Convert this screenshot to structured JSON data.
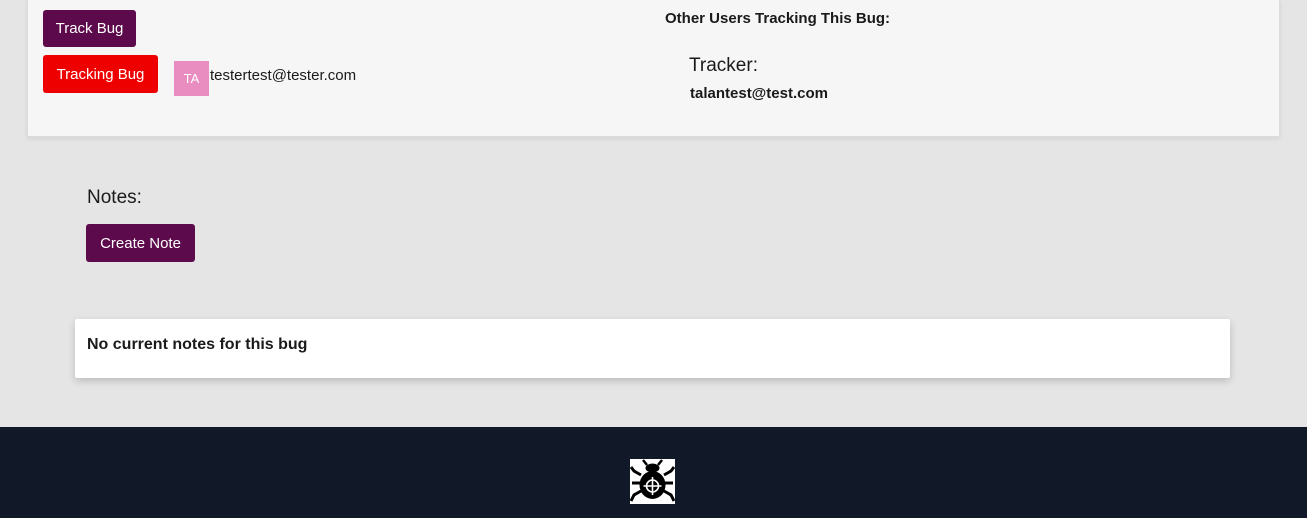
{
  "tracking": {
    "track_button": "Track Bug",
    "tracking_button": "Tracking Bug",
    "current_user": {
      "initials": "TA",
      "email": "testertest@tester.com"
    },
    "others_title": "Other Users Tracking This Bug:",
    "tracker_label": "Tracker:",
    "tracker_email": "talantest@test.com"
  },
  "notes": {
    "heading": "Notes:",
    "create_button": "Create Note",
    "empty_message": "No current notes for this bug"
  },
  "footer": {
    "logo_icon": "bug-icon"
  },
  "colors": {
    "primary": "#5c0a4b",
    "danger": "#ee0000",
    "avatar": "#e98cc0",
    "footer": "#111827",
    "background": "#e5e5e5"
  }
}
